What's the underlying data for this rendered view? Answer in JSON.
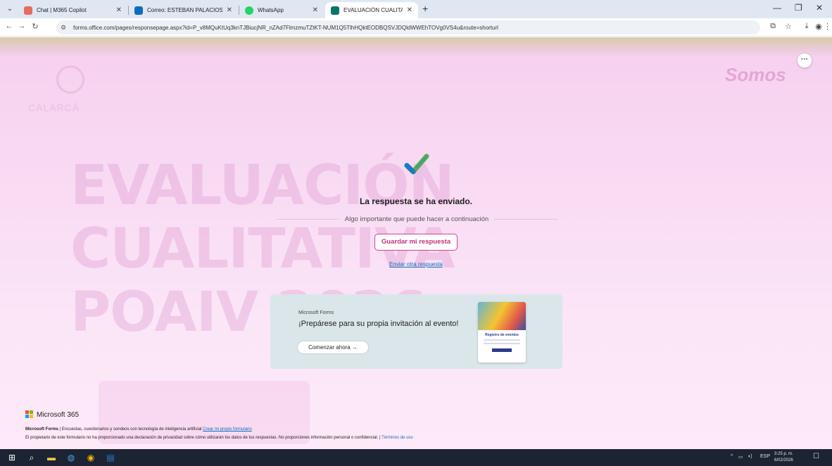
{
  "browser": {
    "tabs": [
      {
        "title": "Chat | M365 Copilot",
        "favicon": "copilot-icon",
        "color": "#e86b5f"
      },
      {
        "title": "Correo: ESTEBAN PALACIOS BE",
        "favicon": "outlook-icon",
        "color": "#0f6cbd"
      },
      {
        "title": "WhatsApp",
        "favicon": "whatsapp-icon",
        "color": "#25d366"
      },
      {
        "title": "EVALUACIÓN CUALITATIVA FIN",
        "favicon": "forms-icon",
        "color": "#077568",
        "active": true
      }
    ],
    "url": "forms.office.com/pages/responsepage.aspx?id=P_v8MQuKtUq3knTJBiucjNR_nZAd7FlmzmuTZtKT-NUM1Q5TlhHQktEODBQSVJDQldWWEhTOVg0VS4u&route=shorturl"
  },
  "background": {
    "lines": [
      "EVALUACIÓN",
      "CUALITATIVA",
      "POAIV 2026"
    ],
    "logo_text": "CALARCÁ",
    "somos": "Somos"
  },
  "response": {
    "title": "La respuesta se ha enviado.",
    "subtitle": "Algo importante que puede hacer a continuación",
    "save_label": "Guardar mi respuesta",
    "again_label": "Enviar otra respuesta"
  },
  "promo": {
    "brand": "Microsoft Forms",
    "title": "¡Prepárese para su propia invitación al evento!",
    "button_label": "Comenzar ahora",
    "card_title": "Registro de eventos"
  },
  "footer": {
    "ms365": "Microsoft 365",
    "line1_bold": "Microsoft Forms",
    "line1_text": " | Encuestas, cuestionarios y sondeos con tecnología de inteligencia artificial ",
    "line1_link": "Crear mi propio formulario",
    "line2_text": "El propietario de este formulario no ha proporcionado una declaración de privacidad sobre cómo utilizarán los datos de tus respuestas. No proporciones información personal o confidencial. | ",
    "line2_link": "Términos de uso"
  },
  "taskbar": {
    "lang": "ESP",
    "time": "3:25 p. m.",
    "date": "6/02/2026"
  },
  "colors": {
    "accent": "#d4408f",
    "link": "#0f6cbd",
    "check_blue": "#1d7ac6",
    "check_green": "#5fb13f"
  }
}
